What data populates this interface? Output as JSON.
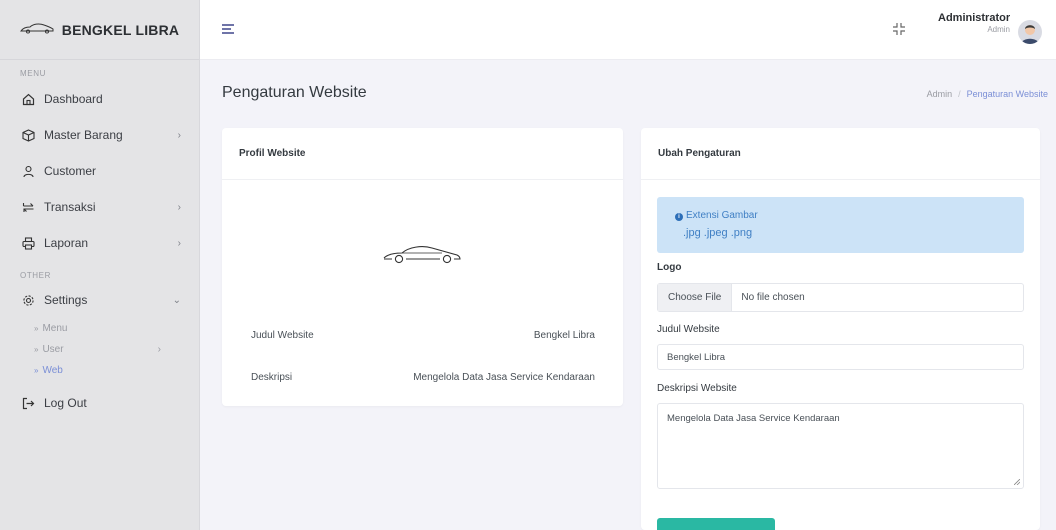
{
  "brand": {
    "name": "BENGKEL LIBRA",
    "logo_icon": "car-icon"
  },
  "sidebar": {
    "menu_heading": "MENU",
    "other_heading": "OTHER",
    "items": [
      {
        "label": "Dashboard",
        "icon": "home-icon"
      },
      {
        "label": "Master Barang",
        "icon": "box-icon",
        "chevron": "›"
      },
      {
        "label": "Customer",
        "icon": "user-icon"
      },
      {
        "label": "Transaksi",
        "icon": "swap-icon",
        "chevron": "›"
      },
      {
        "label": "Laporan",
        "icon": "printer-icon",
        "chevron": "›"
      }
    ],
    "settings": {
      "label": "Settings",
      "icon": "gear-icon",
      "chevron": "⌄"
    },
    "sub_items": [
      {
        "label": "Menu",
        "marker": "»"
      },
      {
        "label": "User",
        "marker": "»",
        "chevron": "›"
      },
      {
        "label": "Web",
        "marker": "»"
      }
    ],
    "logout": {
      "label": "Log Out",
      "icon": "logout-icon"
    }
  },
  "topbar": {
    "menu_icon": "hamburger-icon",
    "fullscreen_icon": "exit-fullscreen-icon",
    "user_name": "Administrator",
    "user_role": "Admin"
  },
  "page": {
    "title": "Pengaturan Website",
    "breadcrumb": {
      "root": "Admin",
      "separator": "/",
      "current": "Pengaturan Website"
    }
  },
  "profile_card": {
    "title": "Profil Website",
    "rows": [
      {
        "label": "Judul Website",
        "value": "Bengkel Libra"
      },
      {
        "label": "Deskripsi",
        "value": "Mengelola Data Jasa Service Kendaraan"
      }
    ]
  },
  "settings_form": {
    "title": "Ubah Pengaturan",
    "alert": {
      "line1": "Extensi Gambar",
      "line2": ".jpg .jpeg .png"
    },
    "logo_label": "Logo",
    "file_button": "Choose File",
    "file_status": "No file chosen",
    "judul_label": "Judul Website",
    "judul_value": "Bengkel Libra",
    "deskripsi_label": "Deskripsi Website",
    "deskripsi_value": "Mengelola Data Jasa Service  Kendaraan"
  },
  "colors": {
    "sidebar_bg": "#e4e4e6",
    "accent": "#7b8fd6",
    "alert_bg": "#cce3f7",
    "submit_button": "#2ab8a3"
  }
}
